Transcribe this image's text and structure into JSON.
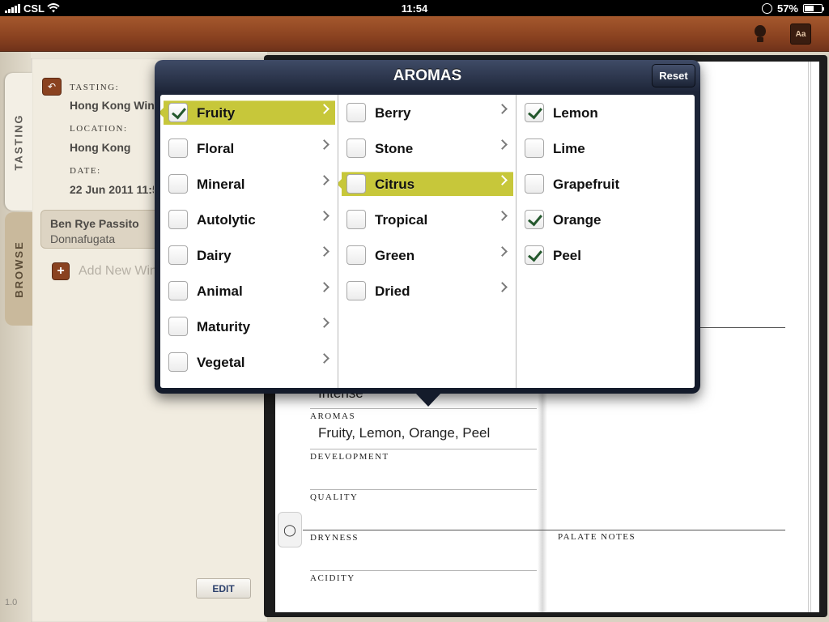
{
  "status_bar": {
    "carrier": "CSL",
    "time": "11:54",
    "battery_percent": "57%",
    "battery_level": 0.57
  },
  "toolbar": {
    "icons": [
      "lightbulb-icon",
      "font-settings-icon"
    ],
    "font_icon_text": "Aa"
  },
  "sidebar": {
    "tabs": [
      "TASTING",
      "BROWSE"
    ],
    "tasting_label": "TASTING:",
    "tasting_value": "Hong Kong Wine",
    "location_label": "LOCATION:",
    "location_value": "Hong Kong",
    "date_label": "DATE:",
    "date_value": "22 Jun 2011 11:54",
    "wine_name": "Ben Rye Passito",
    "wine_producer": "Donnafugata",
    "add_new": "Add New Wine",
    "edit": "EDIT",
    "version": "1.0"
  },
  "notebook": {
    "intensity_value": "Intense",
    "aromas_label": "AROMAS",
    "aromas_value": "Fruity, Lemon, Orange, Peel",
    "development_label": "DEVELOPMENT",
    "quality_label": "QUALITY",
    "dryness_label": "DRYNESS",
    "acidity_label": "ACIDITY",
    "palate_notes_label": "PALATE NOTES"
  },
  "popover": {
    "title": "AROMAS",
    "reset": "Reset",
    "columns": [
      {
        "items": [
          {
            "label": "Fruity",
            "checked": true,
            "selected": true,
            "chevron": true
          },
          {
            "label": "Floral",
            "checked": false,
            "chevron": true
          },
          {
            "label": "Mineral",
            "checked": false,
            "chevron": true
          },
          {
            "label": "Autolytic",
            "checked": false,
            "chevron": true
          },
          {
            "label": "Dairy",
            "checked": false,
            "chevron": true
          },
          {
            "label": "Animal",
            "checked": false,
            "chevron": true
          },
          {
            "label": "Maturity",
            "checked": false,
            "chevron": true
          },
          {
            "label": "Vegetal",
            "checked": false,
            "chevron": true
          }
        ]
      },
      {
        "items": [
          {
            "label": "Berry",
            "checked": false,
            "chevron": true
          },
          {
            "label": "Stone",
            "checked": false,
            "chevron": true
          },
          {
            "label": "Citrus",
            "checked": false,
            "selected": true,
            "chevron": true
          },
          {
            "label": "Tropical",
            "checked": false,
            "chevron": true
          },
          {
            "label": "Green",
            "checked": false,
            "chevron": true
          },
          {
            "label": "Dried",
            "checked": false,
            "chevron": true
          }
        ]
      },
      {
        "items": [
          {
            "label": "Lemon",
            "checked": true,
            "chevron": false
          },
          {
            "label": "Lime",
            "checked": false,
            "chevron": false
          },
          {
            "label": "Grapefruit",
            "checked": false,
            "chevron": false
          },
          {
            "label": "Orange",
            "checked": true,
            "chevron": false
          },
          {
            "label": "Peel",
            "checked": true,
            "chevron": false
          }
        ]
      }
    ]
  },
  "colors": {
    "selection": "#c7c73a",
    "wood": "#8a4220",
    "popover_bg": "#1d2538",
    "check": "#24582d"
  }
}
